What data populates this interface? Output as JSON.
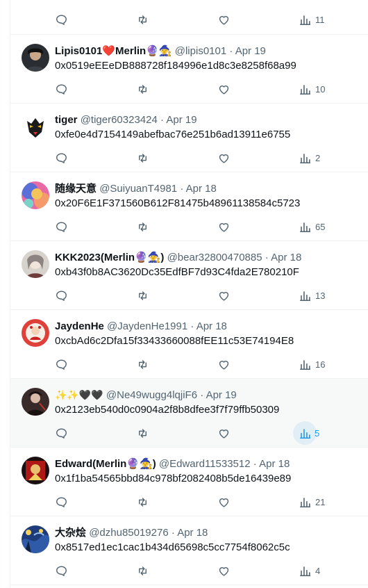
{
  "colors": {
    "text": "#0f1419",
    "muted": "#536471",
    "accent": "#1d9bf0",
    "border": "#eff3f4",
    "hover": "#f7f9f9"
  },
  "tweets": [
    {
      "name": "",
      "handle": "",
      "date": "",
      "text": "",
      "views": "11",
      "avatar": "avatar-partial"
    },
    {
      "name": "Lipis0101❤️Merlin🔮🧙",
      "handle": "@lipis0101",
      "sep": "·",
      "date": "Apr 19",
      "text": "0x0519eEEeDB888728f184996e1d8c3e8258f68a99",
      "views": "10",
      "avatar": "avatar-dark-portrait"
    },
    {
      "name": "tiger",
      "handle": "@tiger60323424",
      "sep": "·",
      "date": "Apr 19",
      "text": "0xfe0e4d7154149abefbac76e251b6ad13911e6755",
      "views": "2",
      "avatar": "avatar-tiger-mask"
    },
    {
      "name": "随缘天意",
      "handle": "@SuiyuanT4981",
      "sep": "·",
      "date": "Apr 18",
      "text": "0x20F6E1F371560B612F81475b48961138584c5723",
      "views": "65",
      "avatar": "avatar-colorful"
    },
    {
      "name": "KKK2023(Merlin🔮🧙)",
      "handle": "@bear32800470885",
      "sep": "·",
      "date": "Apr 18",
      "text": "0xb43f0b8AC3620Dc35EdfBF7d93C4fda2E780210F",
      "views": "13",
      "avatar": "avatar-anime"
    },
    {
      "name": "JaydenHe",
      "handle": "@JaydenHe1991",
      "sep": "·",
      "date": "Apr 18",
      "text": "0xcbAd6c2Dfa15f33433660088fEE11c53E74194E8",
      "views": "16",
      "avatar": "avatar-red-sticker"
    },
    {
      "name": "✨✨🖤🖤",
      "handle": "@Ne49wugg4lqjiF6",
      "sep": "·",
      "date": "Apr 19",
      "text": "0x2123eb540d0c0904a2f8b8dfee3f7f79ffb50309",
      "views": "5",
      "avatar": "avatar-dark-figure",
      "hover": true
    },
    {
      "name": "Edward(Merlin🔮🧙)",
      "handle": "@Edward11533512",
      "sep": "·",
      "date": "Apr 18",
      "text": "0x1f1ba54565bbd84c978bf2082408b5de16439e89",
      "views": "21",
      "avatar": "avatar-red-art"
    },
    {
      "name": "大杂烩",
      "handle": "@dzhu85019276",
      "sep": "·",
      "date": "Apr 18",
      "text": "0x8517ed1ec1cac1b434d65698c5cc7754f8062c5c",
      "views": "4",
      "avatar": "avatar-starry-night"
    }
  ],
  "icons": {
    "reply": "reply-icon",
    "retweet": "retweet-icon",
    "like": "like-icon",
    "views": "views-icon"
  }
}
